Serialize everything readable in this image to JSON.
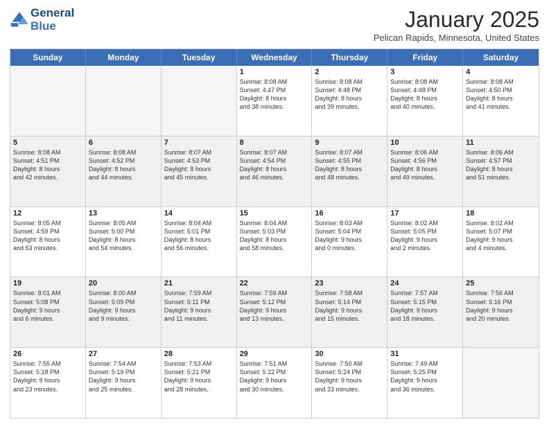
{
  "header": {
    "logo_line1": "General",
    "logo_line2": "Blue",
    "month_title": "January 2025",
    "location": "Pelican Rapids, Minnesota, United States"
  },
  "days_of_week": [
    "Sunday",
    "Monday",
    "Tuesday",
    "Wednesday",
    "Thursday",
    "Friday",
    "Saturday"
  ],
  "weeks": [
    [
      {
        "day": "",
        "empty": true
      },
      {
        "day": "",
        "empty": true
      },
      {
        "day": "",
        "empty": true
      },
      {
        "day": "1",
        "lines": [
          "Sunrise: 8:08 AM",
          "Sunset: 4:47 PM",
          "Daylight: 8 hours",
          "and 38 minutes."
        ]
      },
      {
        "day": "2",
        "lines": [
          "Sunrise: 8:08 AM",
          "Sunset: 4:48 PM",
          "Daylight: 8 hours",
          "and 39 minutes."
        ]
      },
      {
        "day": "3",
        "lines": [
          "Sunrise: 8:08 AM",
          "Sunset: 4:48 PM",
          "Daylight: 8 hours",
          "and 40 minutes."
        ]
      },
      {
        "day": "4",
        "lines": [
          "Sunrise: 8:08 AM",
          "Sunset: 4:50 PM",
          "Daylight: 8 hours",
          "and 41 minutes."
        ]
      }
    ],
    [
      {
        "day": "5",
        "lines": [
          "Sunrise: 8:08 AM",
          "Sunset: 4:51 PM",
          "Daylight: 8 hours",
          "and 42 minutes."
        ]
      },
      {
        "day": "6",
        "lines": [
          "Sunrise: 8:08 AM",
          "Sunset: 4:52 PM",
          "Daylight: 8 hours",
          "and 44 minutes."
        ]
      },
      {
        "day": "7",
        "lines": [
          "Sunrise: 8:07 AM",
          "Sunset: 4:53 PM",
          "Daylight: 8 hours",
          "and 45 minutes."
        ]
      },
      {
        "day": "8",
        "lines": [
          "Sunrise: 8:07 AM",
          "Sunset: 4:54 PM",
          "Daylight: 8 hours",
          "and 46 minutes."
        ]
      },
      {
        "day": "9",
        "lines": [
          "Sunrise: 8:07 AM",
          "Sunset: 4:55 PM",
          "Daylight: 8 hours",
          "and 48 minutes."
        ]
      },
      {
        "day": "10",
        "lines": [
          "Sunrise: 8:06 AM",
          "Sunset: 4:56 PM",
          "Daylight: 8 hours",
          "and 49 minutes."
        ]
      },
      {
        "day": "11",
        "lines": [
          "Sunrise: 8:06 AM",
          "Sunset: 4:57 PM",
          "Daylight: 8 hours",
          "and 51 minutes."
        ]
      }
    ],
    [
      {
        "day": "12",
        "lines": [
          "Sunrise: 8:05 AM",
          "Sunset: 4:59 PM",
          "Daylight: 8 hours",
          "and 53 minutes."
        ]
      },
      {
        "day": "13",
        "lines": [
          "Sunrise: 8:05 AM",
          "Sunset: 5:00 PM",
          "Daylight: 8 hours",
          "and 54 minutes."
        ]
      },
      {
        "day": "14",
        "lines": [
          "Sunrise: 8:04 AM",
          "Sunset: 5:01 PM",
          "Daylight: 8 hours",
          "and 56 minutes."
        ]
      },
      {
        "day": "15",
        "lines": [
          "Sunrise: 8:04 AM",
          "Sunset: 5:03 PM",
          "Daylight: 8 hours",
          "and 58 minutes."
        ]
      },
      {
        "day": "16",
        "lines": [
          "Sunrise: 8:03 AM",
          "Sunset: 5:04 PM",
          "Daylight: 9 hours",
          "and 0 minutes."
        ]
      },
      {
        "day": "17",
        "lines": [
          "Sunrise: 8:02 AM",
          "Sunset: 5:05 PM",
          "Daylight: 9 hours",
          "and 2 minutes."
        ]
      },
      {
        "day": "18",
        "lines": [
          "Sunrise: 8:02 AM",
          "Sunset: 5:07 PM",
          "Daylight: 9 hours",
          "and 4 minutes."
        ]
      }
    ],
    [
      {
        "day": "19",
        "lines": [
          "Sunrise: 8:01 AM",
          "Sunset: 5:08 PM",
          "Daylight: 9 hours",
          "and 6 minutes."
        ]
      },
      {
        "day": "20",
        "lines": [
          "Sunrise: 8:00 AM",
          "Sunset: 5:09 PM",
          "Daylight: 9 hours",
          "and 9 minutes."
        ]
      },
      {
        "day": "21",
        "lines": [
          "Sunrise: 7:59 AM",
          "Sunset: 5:11 PM",
          "Daylight: 9 hours",
          "and 11 minutes."
        ]
      },
      {
        "day": "22",
        "lines": [
          "Sunrise: 7:59 AM",
          "Sunset: 5:12 PM",
          "Daylight: 9 hours",
          "and 13 minutes."
        ]
      },
      {
        "day": "23",
        "lines": [
          "Sunrise: 7:58 AM",
          "Sunset: 5:14 PM",
          "Daylight: 9 hours",
          "and 15 minutes."
        ]
      },
      {
        "day": "24",
        "lines": [
          "Sunrise: 7:57 AM",
          "Sunset: 5:15 PM",
          "Daylight: 9 hours",
          "and 18 minutes."
        ]
      },
      {
        "day": "25",
        "lines": [
          "Sunrise: 7:56 AM",
          "Sunset: 5:16 PM",
          "Daylight: 9 hours",
          "and 20 minutes."
        ]
      }
    ],
    [
      {
        "day": "26",
        "lines": [
          "Sunrise: 7:55 AM",
          "Sunset: 5:18 PM",
          "Daylight: 9 hours",
          "and 23 minutes."
        ]
      },
      {
        "day": "27",
        "lines": [
          "Sunrise: 7:54 AM",
          "Sunset: 5:19 PM",
          "Daylight: 9 hours",
          "and 25 minutes."
        ]
      },
      {
        "day": "28",
        "lines": [
          "Sunrise: 7:53 AM",
          "Sunset: 5:21 PM",
          "Daylight: 9 hours",
          "and 28 minutes."
        ]
      },
      {
        "day": "29",
        "lines": [
          "Sunrise: 7:51 AM",
          "Sunset: 5:22 PM",
          "Daylight: 9 hours",
          "and 30 minutes."
        ]
      },
      {
        "day": "30",
        "lines": [
          "Sunrise: 7:50 AM",
          "Sunset: 5:24 PM",
          "Daylight: 9 hours",
          "and 33 minutes."
        ]
      },
      {
        "day": "31",
        "lines": [
          "Sunrise: 7:49 AM",
          "Sunset: 5:25 PM",
          "Daylight: 9 hours",
          "and 36 minutes."
        ]
      },
      {
        "day": "",
        "empty": true
      }
    ]
  ]
}
